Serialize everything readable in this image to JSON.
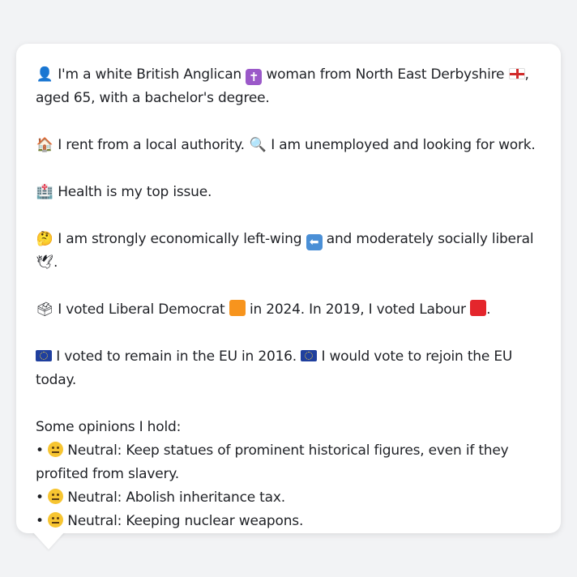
{
  "persona": {
    "intro_emoji": "👤",
    "intro_a": "I'm a white British Anglican",
    "religion_emoji": "✝",
    "intro_b": "woman from North East Derbyshire",
    "intro_c": ",",
    "intro_line2": "aged 65, with a bachelor's degree.",
    "housing_emoji": "🏠",
    "housing_text": "I rent from a local authority.",
    "work_emoji": "🔍",
    "work_text": "I am unemployed and looking for work.",
    "health_emoji": "🏥",
    "health_text": "Health is my top issue.",
    "econ_emoji": "🤔",
    "econ_text_a": "I am strongly economically left-wing",
    "econ_arrow": "⬅",
    "econ_text_b": "and moderately socially liberal",
    "econ_dove": "🕊",
    "econ_end": ".",
    "vote_emoji": "🗳",
    "vote_text_a": "I voted Liberal Democrat",
    "vote_text_b": "in 2024. In 2019, I voted Labour",
    "vote_end": ".",
    "lib_dem_color": "#f7941d",
    "labour_color": "#e4262c",
    "eu_text_a": "I voted to remain in the EU in 2016.",
    "eu_text_b": "I would vote to rejoin the EU today.",
    "opinions_header": "Some opinions I hold:",
    "opinions": [
      {
        "bullet": "•",
        "stance": "Neutral:",
        "text_a": "Keep statues of prominent historical figures, even if they",
        "text_b": "profited from slavery."
      },
      {
        "bullet": "•",
        "stance": "Neutral:",
        "text_a": "Abolish inheritance tax.",
        "text_b": ""
      },
      {
        "bullet": "•",
        "stance": "Neutral:",
        "text_a": "Keeping nuclear weapons.",
        "text_b": ""
      }
    ]
  }
}
